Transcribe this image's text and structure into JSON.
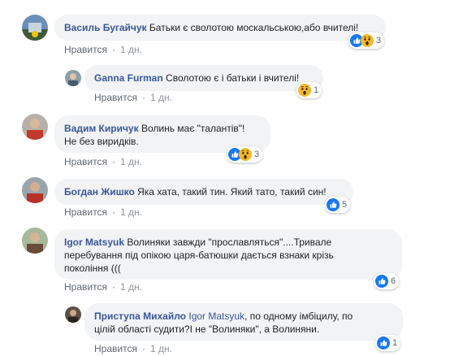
{
  "comments": [
    {
      "author": "Василь Бугайчук",
      "text": "Батьки є сволотою москальською,або вчителі!",
      "like": "Нравится",
      "time": "1 дн.",
      "reaction_count": "3",
      "reactions": [
        "like-reaction-icon",
        "wow-reaction-icon"
      ]
    },
    {
      "author": "Ganna Furman",
      "text": "Сволотою є і батьки і вчителі!",
      "like": "Нравится",
      "time": "1 дн.",
      "reaction_count": "1",
      "reactions": [
        "wow-reaction-icon"
      ]
    },
    {
      "author": "Вадим Киричук",
      "text_line1": "Волинь має \"талантів\"!",
      "text_line2": "Не без виридків.",
      "like": "Нравится",
      "time": "1 дн.",
      "reaction_count": "3",
      "reactions": [
        "like-reaction-icon",
        "wow-reaction-icon"
      ]
    },
    {
      "author": "Богдан Жишко",
      "text": "Яка хата, такий тин. Який тато, такий син!",
      "like": "Нравится",
      "time": "1 дн.",
      "reaction_count": "5",
      "reactions": [
        "like-reaction-icon"
      ]
    },
    {
      "author": "Igor Matsyuk",
      "text_line1": "Волиняки завжди \"прославляться\"....Тривале",
      "text_line2": "перебування під опікою царя-батюшки дається взнаки крізь",
      "text_line3": "покоління (((",
      "like": "Нравится",
      "time": "1 дн.",
      "reaction_count": "6",
      "reactions": [
        "like-reaction-icon"
      ]
    },
    {
      "author": "Приступа Михайло",
      "mention": "Igor Matsyuk",
      "text_line1": ", по одному імбіцилу, по",
      "text_line2": "цілій області судити?І не \"Волиняки\", а Волиняни.",
      "like": "Нравится",
      "time": "1 дн.",
      "reaction_count": "1",
      "reactions": [
        "like-reaction-icon"
      ]
    }
  ],
  "colors": {
    "bubble": "#f2f3f5",
    "author": "#385898",
    "like_blue": "#1877f2",
    "wow_yellow": "#f7b928"
  }
}
